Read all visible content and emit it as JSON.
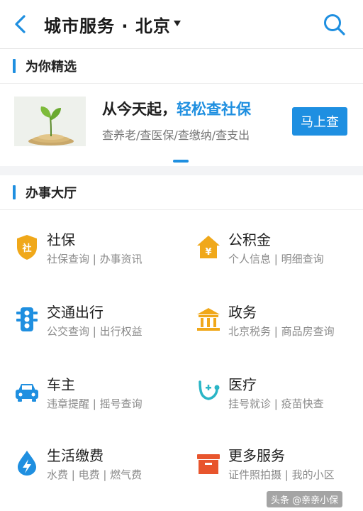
{
  "header": {
    "title": "城市服务 · 北京",
    "back_icon": "chevron-left-icon",
    "search_icon": "search-icon"
  },
  "featured": {
    "section_title": "为你精选",
    "title_part1": "从今天起，",
    "title_highlight": "轻松查社保",
    "subtitle": "查养老/查医保/查缴纳/查支出",
    "button_label": "马上查"
  },
  "services": {
    "section_title": "办事大厅",
    "items": [
      {
        "name": "社保",
        "desc": "社保查询 | 办事资讯",
        "icon": "social-security-shield-icon"
      },
      {
        "name": "公积金",
        "desc": "个人信息 | 明细查询",
        "icon": "housing-fund-house-icon"
      },
      {
        "name": "交通出行",
        "desc": "公交查询 | 出行权益",
        "icon": "traffic-light-icon"
      },
      {
        "name": "政务",
        "desc": "北京税务 | 商品房查询",
        "icon": "government-building-icon"
      },
      {
        "name": "车主",
        "desc": "违章提醒 | 摇号查询",
        "icon": "car-icon"
      },
      {
        "name": "医疗",
        "desc": "挂号就诊 | 疫苗快查",
        "icon": "stethoscope-icon"
      },
      {
        "name": "生活缴费",
        "desc": "水费 | 电费 | 燃气费",
        "icon": "water-drop-bolt-icon"
      },
      {
        "name": "更多服务",
        "desc": "证件照拍摄 | 我的小区",
        "icon": "box-icon"
      }
    ]
  },
  "watermark": "头条 @亲亲小保",
  "colors": {
    "accent": "#1f8fe0",
    "social_security": "#f0a81a",
    "housing_fund": "#f0a81a",
    "traffic": "#1f8fe0",
    "government": "#f0a81a",
    "car": "#1f8fe0",
    "medical": "#2ab5c6",
    "utilities": "#1f8fe0",
    "more": "#e8552d"
  }
}
